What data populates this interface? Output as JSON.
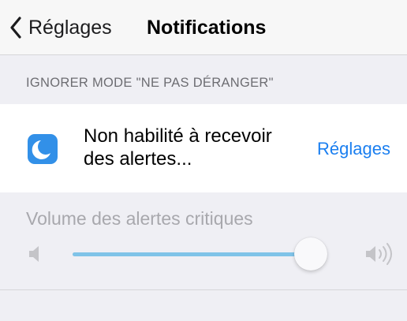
{
  "nav": {
    "back_label": "Réglages",
    "title": "Notifications",
    "back_icon": "chevron-left-icon"
  },
  "section": {
    "header": "IGNORER MODE \"NE PAS DÉRANGER\""
  },
  "cell": {
    "icon": "moon-icon",
    "text": "Non habilité à recevoir des alertes...",
    "action_label": "Réglages"
  },
  "volume": {
    "label": "Volume des alertes critiques",
    "level": 0.95,
    "low_icon": "speaker-low-icon",
    "high_icon": "speaker-high-icon"
  },
  "colors": {
    "accent": "#1b7ff0",
    "icon_bg": "#3290e8",
    "slider_fill": "#7fc3e8"
  }
}
